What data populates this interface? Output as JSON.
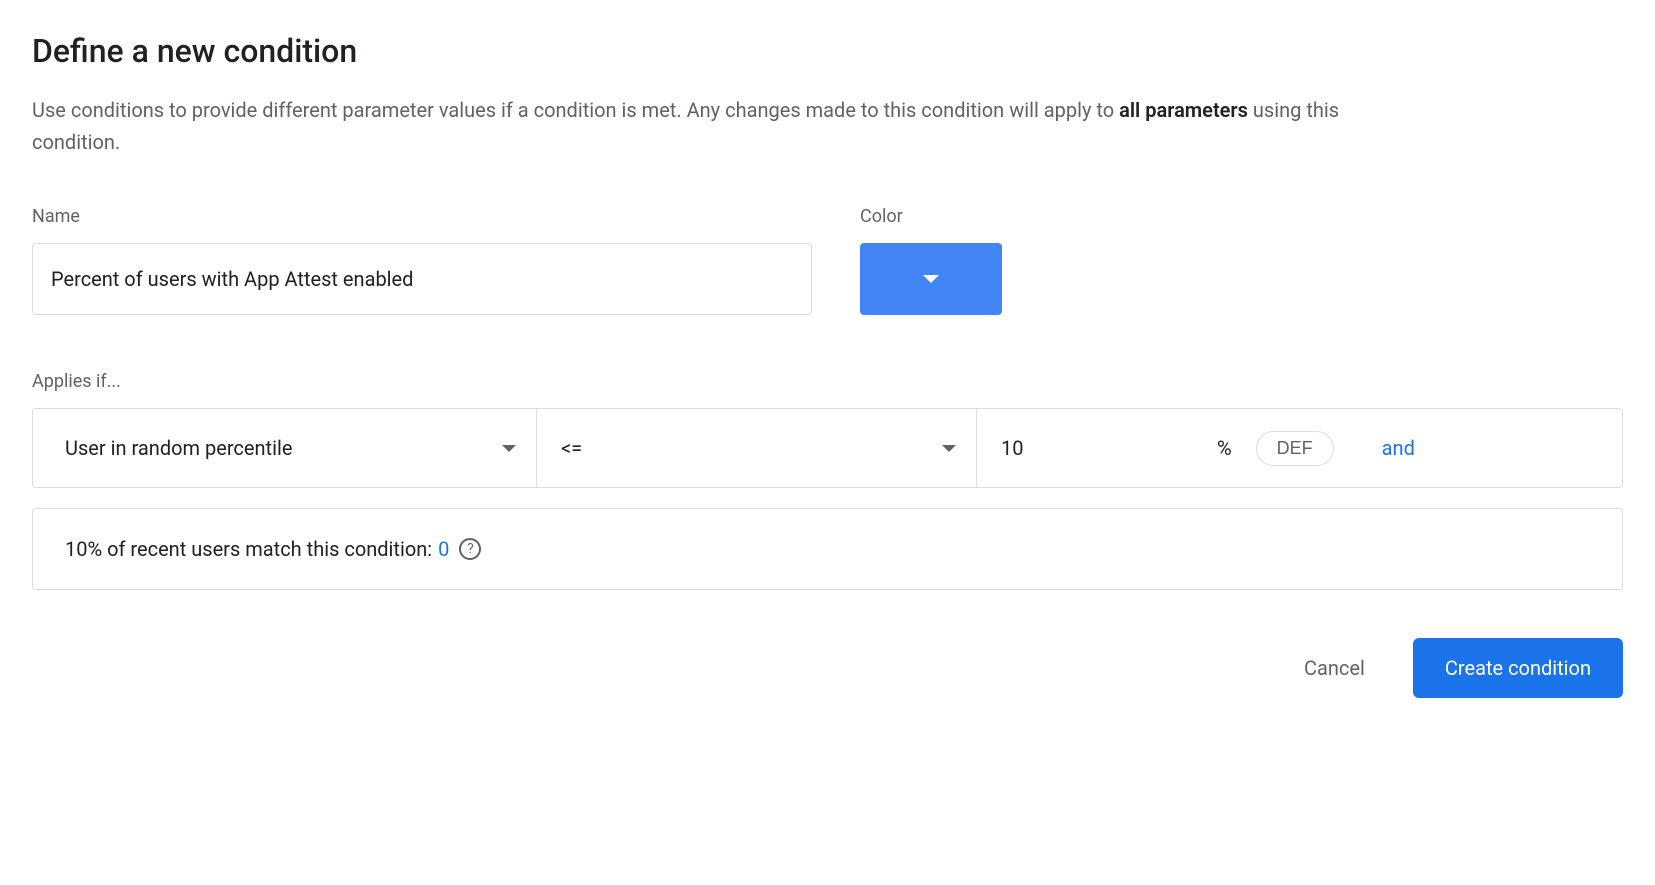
{
  "title": "Define a new condition",
  "description": {
    "part1": "Use conditions to provide different parameter values if a condition is met. Any changes made to this condition will apply to ",
    "bold": "all parameters",
    "part2": " using this condition."
  },
  "form": {
    "name_label": "Name",
    "name_value": "Percent of users with App Attest enabled",
    "color_label": "Color",
    "color_value": "#4285f4"
  },
  "applies": {
    "label": "Applies if...",
    "condition_type": "User in random percentile",
    "operator": "<=",
    "value": "10",
    "unit": "%",
    "def_label": "DEF",
    "and_label": "and"
  },
  "match_info": {
    "text": "10% of recent users match this condition: ",
    "count": "0"
  },
  "actions": {
    "cancel": "Cancel",
    "create": "Create condition"
  }
}
